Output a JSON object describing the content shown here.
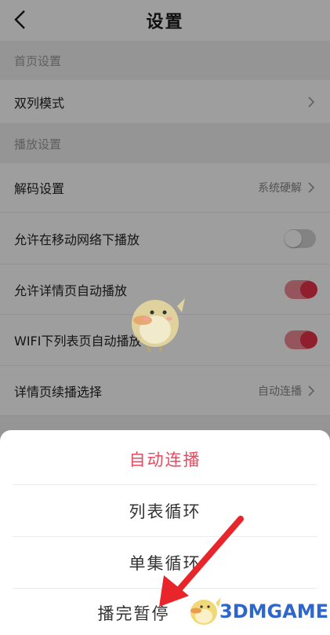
{
  "header": {
    "title": "设置",
    "back_icon": "chevron-left-icon"
  },
  "sections": {
    "home": {
      "title": "首页设置",
      "items": [
        {
          "label": "双列模式",
          "value": "",
          "control": "chevron"
        }
      ]
    },
    "playback": {
      "title": "播放设置",
      "items": [
        {
          "label": "解码设置",
          "value": "系统硬解",
          "control": "chevron"
        },
        {
          "label": "允许在移动网络下播放",
          "control": "toggle",
          "on": false
        },
        {
          "label": "允许详情页自动播放",
          "control": "toggle",
          "on": true
        },
        {
          "label": "WIFI下列表页自动播放",
          "control": "toggle",
          "on": true
        },
        {
          "label": "详情页续播选择",
          "value": "自动连播",
          "control": "chevron"
        }
      ]
    }
  },
  "sheet": {
    "options": [
      {
        "label": "自动连播",
        "selected": true
      },
      {
        "label": "列表循环",
        "selected": false
      },
      {
        "label": "单集循环",
        "selected": false
      },
      {
        "label": "播完暂停",
        "selected": false
      }
    ]
  },
  "watermark": {
    "text": "3DMGAME"
  },
  "colors": {
    "accent": "#e84a5f",
    "toggle_on_track": "#f08a95",
    "toggle_on_knob": "#e8324a",
    "toggle_off_track": "#d4d4d4",
    "watermark": "#2f66c9",
    "annotation_arrow": "#e8252a"
  }
}
